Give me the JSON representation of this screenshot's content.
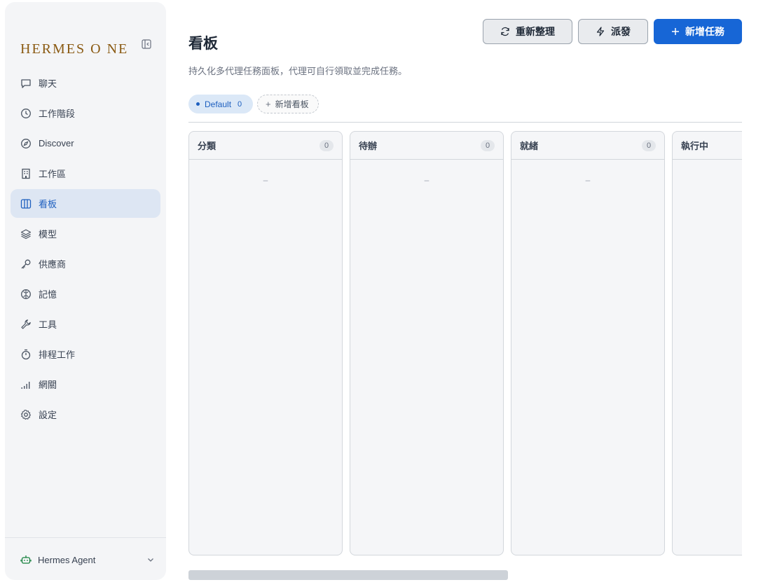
{
  "sidebar": {
    "brand": "HERMES O NE",
    "items": [
      {
        "label": "聊天",
        "icon": "chat-icon"
      },
      {
        "label": "工作階段",
        "icon": "clock-icon"
      },
      {
        "label": "Discover",
        "icon": "compass-icon"
      },
      {
        "label": "工作區",
        "icon": "building-icon"
      },
      {
        "label": "看板",
        "icon": "kanban-icon",
        "active": true
      },
      {
        "label": "模型",
        "icon": "layers-icon"
      },
      {
        "label": "供應商",
        "icon": "key-icon"
      },
      {
        "label": "記憶",
        "icon": "brain-icon"
      },
      {
        "label": "工具",
        "icon": "wrench-icon"
      },
      {
        "label": "排程工作",
        "icon": "timer-icon"
      },
      {
        "label": "網關",
        "icon": "signal-icon"
      },
      {
        "label": "設定",
        "icon": "gear-icon"
      }
    ],
    "agent": {
      "label": "Hermes Agent",
      "icon": "robot-icon"
    }
  },
  "header": {
    "title": "看板",
    "subtitle": "持久化多代理任務面板，代理可自行領取並完成任務。",
    "refresh_label": "重新整理",
    "dispatch_label": "派發",
    "new_task_label": "新增任務"
  },
  "boards": {
    "default_label": "Default",
    "default_count": "0",
    "add_label": "新增看板"
  },
  "columns": [
    {
      "title": "分類",
      "count": "0",
      "empty": "–"
    },
    {
      "title": "待辦",
      "count": "0",
      "empty": "–"
    },
    {
      "title": "就緒",
      "count": "0",
      "empty": "–"
    },
    {
      "title": "執行中",
      "count": "",
      "empty": ""
    }
  ],
  "colors": {
    "accent": "#1766d6",
    "brand": "#8a5a12",
    "active_bg": "#dde6f3"
  }
}
